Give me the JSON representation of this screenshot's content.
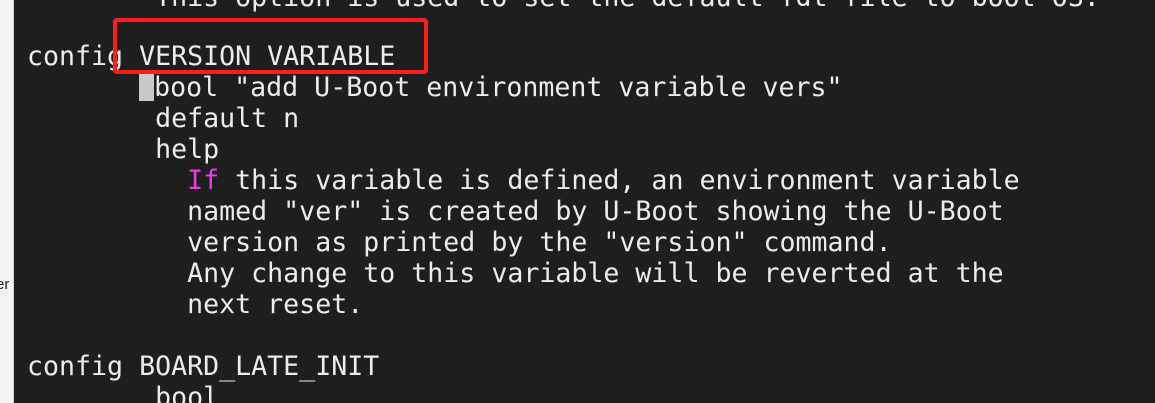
{
  "left_panel": {
    "fragment": "er"
  },
  "terminal": {
    "lines": [
      {
        "text": "        This option is used to set the default fdt file to boot OS."
      },
      {
        "text": ""
      },
      {
        "text": "config VERSION_VARIABLE"
      },
      {
        "pre": "       ",
        "text": "bool \"add U-Boot environment variable vers\""
      },
      {
        "text": "        default n"
      },
      {
        "text": "        help"
      },
      {
        "pre": "          ",
        "keyword": "If",
        "text": " this variable is defined, an environment variable"
      },
      {
        "text": "          named \"ver\" is created by U-Boot showing the U-Boot"
      },
      {
        "text": "          version as printed by the \"version\" command."
      },
      {
        "text": "          Any change to this variable will be reverted at the"
      },
      {
        "text": "          next reset."
      },
      {
        "text": ""
      },
      {
        "text": "config BOARD_LATE_INIT"
      },
      {
        "text": "        bool"
      }
    ]
  },
  "colors": {
    "background": "#1e1e1e",
    "text": "#ececec",
    "keyword": "#e83ee8",
    "highlight_box": "#ff1e1e"
  }
}
